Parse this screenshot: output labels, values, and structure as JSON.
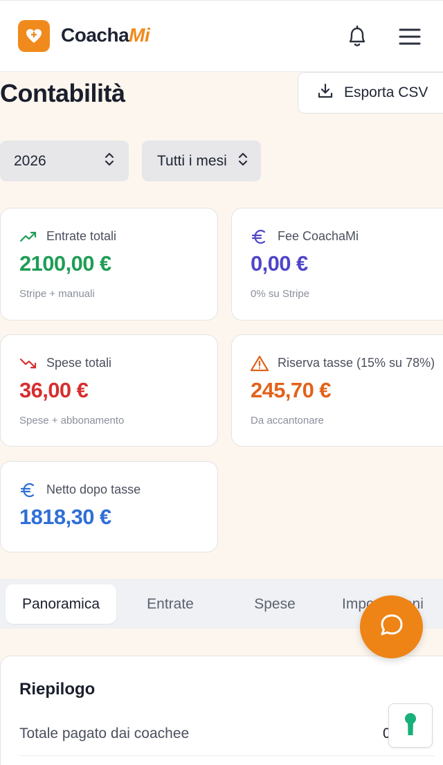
{
  "header": {
    "brand_main": "Coacha",
    "brand_accent": "Mi",
    "logo_icon": "heart-plus-icon",
    "bell_icon": "bell-icon",
    "menu_icon": "hamburger-menu-icon"
  },
  "page": {
    "title": "Contabilità",
    "export_label": "Esporta CSV",
    "export_icon": "download-icon"
  },
  "filters": {
    "year": "2026",
    "month": "Tutti i mesi"
  },
  "cards": [
    {
      "label": "Entrate totali",
      "value": "2100,00 €",
      "sub": "Stripe + manuali",
      "icon": "trending-up-icon",
      "color": "#1f9d55"
    },
    {
      "label": "Fee CoachaMi",
      "value": "0,00 €",
      "sub": "0% su Stripe",
      "icon": "euro-icon",
      "color": "#4f46c8"
    },
    {
      "label": "Spese totali",
      "value": "36,00 €",
      "sub": "Spese + abbonamento",
      "icon": "trending-down-icon",
      "color": "#d62f2f"
    },
    {
      "label": "Riserva tasse (15% su 78%)",
      "value": "245,70 €",
      "sub": "Da accantonare",
      "icon": "warning-icon",
      "color": "#e2621b"
    },
    {
      "label": "Netto dopo tasse",
      "value": "1818,30 €",
      "sub": "",
      "icon": "euro-icon",
      "color": "#2f6fd6"
    }
  ],
  "tabs": [
    "Panoramica",
    "Entrate",
    "Spese",
    "Impostazioni"
  ],
  "active_tab": "Panoramica",
  "summary": {
    "title": "Riepilogo",
    "row_label": "Totale pagato dai coachee",
    "row_value": "0"
  },
  "fab_icon": "chat-bubble-icon",
  "keyhole_icon": "keyhole-icon",
  "colors": {
    "brand": "#f08a1c",
    "background": "#fdf6ee"
  }
}
